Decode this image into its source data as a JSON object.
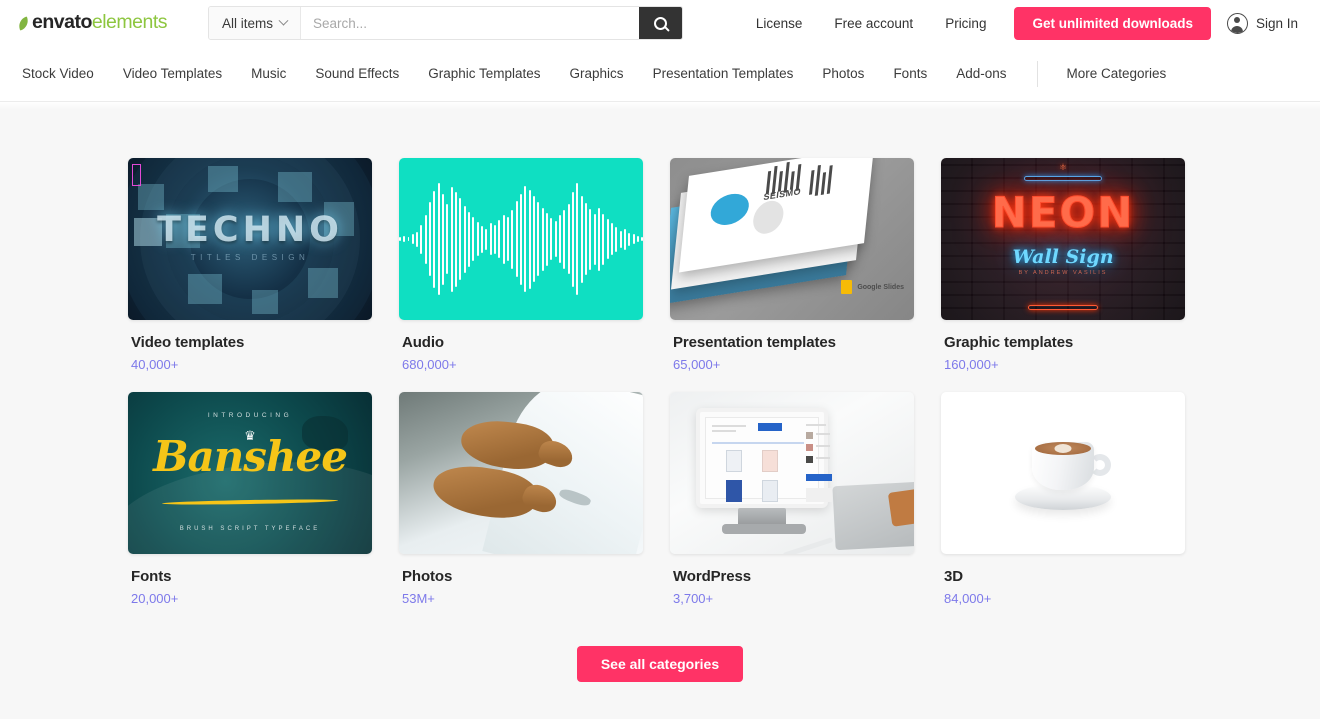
{
  "header": {
    "logo": {
      "brand": "envato",
      "product": "elements",
      "leaf_icon": "leaf-icon"
    },
    "search": {
      "scope_label": "All items",
      "placeholder": "Search...",
      "value": "",
      "search_icon": "search-icon",
      "chevron_icon": "chevron-down-icon"
    },
    "links": [
      {
        "label": "License"
      },
      {
        "label": "Free account"
      },
      {
        "label": "Pricing"
      }
    ],
    "cta_label": "Get unlimited downloads",
    "signin_label": "Sign In",
    "avatar_icon": "user-avatar-icon",
    "accent_color": "#ff3366",
    "brand_green": "#8dc63f"
  },
  "nav": {
    "items": [
      {
        "label": "Stock Video"
      },
      {
        "label": "Video Templates"
      },
      {
        "label": "Music"
      },
      {
        "label": "Sound Effects"
      },
      {
        "label": "Graphic Templates"
      },
      {
        "label": "Graphics"
      },
      {
        "label": "Presentation Templates"
      },
      {
        "label": "Photos"
      },
      {
        "label": "Fonts"
      },
      {
        "label": "Add-ons"
      }
    ],
    "more_label": "More Categories"
  },
  "main": {
    "cards": [
      {
        "title": "Video templates",
        "count": "40,000+",
        "art": {
          "kind": "techno-video-thumbnail",
          "headline": "TECHNO",
          "subline": "TITLES DESIGN"
        }
      },
      {
        "title": "Audio",
        "count": "680,000+",
        "art": {
          "kind": "audio-waveform-thumbnail",
          "background_color": "#0fdfc2",
          "bar_color": "#ffffff"
        }
      },
      {
        "title": "Presentation templates",
        "count": "65,000+",
        "art": {
          "kind": "presentation-slides-thumbnail",
          "slide_headline": "SEISMO",
          "badge_label": "Google Slides"
        }
      },
      {
        "title": "Graphic templates",
        "count": "160,000+",
        "art": {
          "kind": "neon-sign-thumbnail",
          "headline": "NEON",
          "subline": "Wall Sign",
          "tagline": "BY ANDREW VASILIS"
        }
      },
      {
        "title": "Fonts",
        "count": "20,000+",
        "art": {
          "kind": "banshee-font-thumbnail",
          "intro": "INTRODUCING",
          "headline": "Banshee",
          "subline": "BRUSH SCRIPT TYPEFACE"
        }
      },
      {
        "title": "Photos",
        "count": "53M+",
        "art": {
          "kind": "bears-waterfall-photo-thumbnail"
        }
      },
      {
        "title": "WordPress",
        "count": "3,700+",
        "art": {
          "kind": "tablet-website-thumbnail"
        }
      },
      {
        "title": "3D",
        "count": "84,000+",
        "art": {
          "kind": "coffee-cup-render-thumbnail"
        }
      }
    ],
    "see_all_label": "See all categories",
    "count_color": "#7d79ea"
  }
}
